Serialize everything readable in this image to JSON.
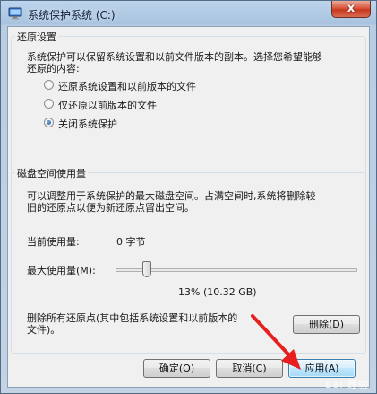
{
  "window": {
    "title": "系统保护系统 (C:)",
    "close_label": "x"
  },
  "restore": {
    "group_title": "还原设置",
    "description_line1": "系统保护可以保留系统设置和以前文件版本的副本。选择您希望能够",
    "description_line2": "还原的内容:",
    "options": [
      {
        "label": "还原系统设置和以前版本的文件",
        "checked": false
      },
      {
        "label": "仅还原以前版本的文件",
        "checked": false
      },
      {
        "label": "关闭系统保护",
        "checked": true
      }
    ]
  },
  "disk": {
    "group_title": "磁盘空间使用量",
    "description_line1": "可以调整用于系统保护的最大磁盘空间。占满空间时,系统将删除较",
    "description_line2": "旧的还原点以便为新还原点留出空间。",
    "current_usage_label": "当前使用量:",
    "current_usage_value": "0 字节",
    "max_usage_label": "最大使用量(M):",
    "max_usage_fraction": 0.13,
    "max_usage_value": "13% (10.32 GB)",
    "delete_text_line1": "删除所有还原点(其中包括系统设置和以前版本的",
    "delete_text_line2": "文件)。",
    "delete_button": "删除(D)"
  },
  "footer": {
    "ok": "确定(O)",
    "cancel": "取消(C)",
    "apply": "应用(A)"
  },
  "watermark": "Bai 经验"
}
